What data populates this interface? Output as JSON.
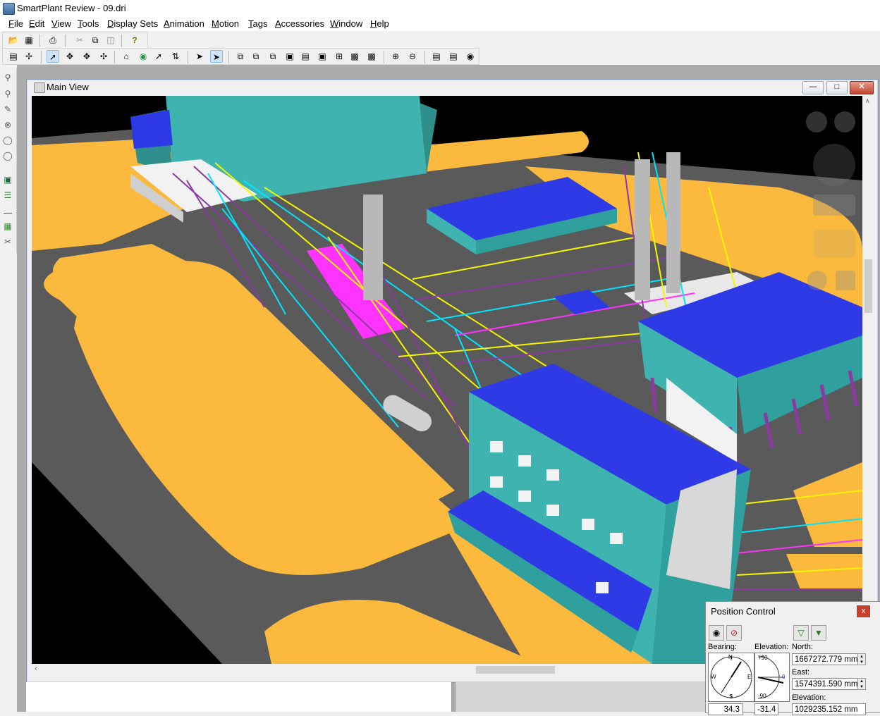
{
  "window": {
    "title": "SmartPlant Review - 09.dri"
  },
  "menu": [
    "File",
    "Edit",
    "View",
    "Tools",
    "Display Sets",
    "Animation",
    "Motion",
    "Tags",
    "Accessories",
    "Window",
    "Help"
  ],
  "toolbar1": {
    "icons": [
      "open-icon",
      "save-icon",
      "print-icon",
      "cut-icon",
      "copy-icon",
      "paste-icon",
      "help-icon"
    ]
  },
  "toolbar2": {
    "icons": [
      "document-icon",
      "move-icon",
      "select-icon",
      "pan-icon",
      "walk-icon",
      "rotate-icon",
      "home-view-icon",
      "look-icon",
      "fly-icon",
      "turn-icon",
      "pointer-icon",
      "pointer-pressed-icon",
      "view-iso-icon",
      "view-top-icon",
      "view-front-icon",
      "view-side-icon",
      "view-back-icon",
      "view-fit-icon",
      "view-bottom-icon",
      "view-right-icon",
      "zoom-in-icon",
      "zoom-out-icon",
      "properties-icon",
      "tag-icon",
      "camera-icon"
    ]
  },
  "left_tools": [
    "zoom-icon",
    "search-icon",
    "inspect-icon",
    "clip-icon",
    "lasso-icon",
    "find-icon",
    "view-icon",
    "layers-icon",
    "measure-icon",
    "grid-icon",
    "scissors-icon"
  ],
  "main_view": {
    "title": "Main View"
  },
  "position_control": {
    "title": "Position Control",
    "close_label": "x",
    "bearing_label": "Bearing:",
    "elevation_label": "Elevation:",
    "north_label": "North:",
    "east_label": "East:",
    "elev_label": "Elevation:",
    "north_value": "1667272.779 mm",
    "east_value": "1574391.590 mm",
    "elevation_value": "1029235.152 mm",
    "bearing_value": "34.3",
    "elevation_angle": "-31.4",
    "compass": {
      "n": "N",
      "s": "S",
      "e": "E",
      "w": "W"
    },
    "elev_scale": {
      "top": "+90",
      "bottom": "-90",
      "zero": "0"
    }
  },
  "colors": {
    "ground": "#fbb93d",
    "road": "#5a5a5a",
    "roof": "#2e3ae6",
    "wall": "#3fb3b0",
    "pipe_magenta": "#ff33ff",
    "pipe_yellow": "#f5f500",
    "steel": "#8a3aa0"
  }
}
